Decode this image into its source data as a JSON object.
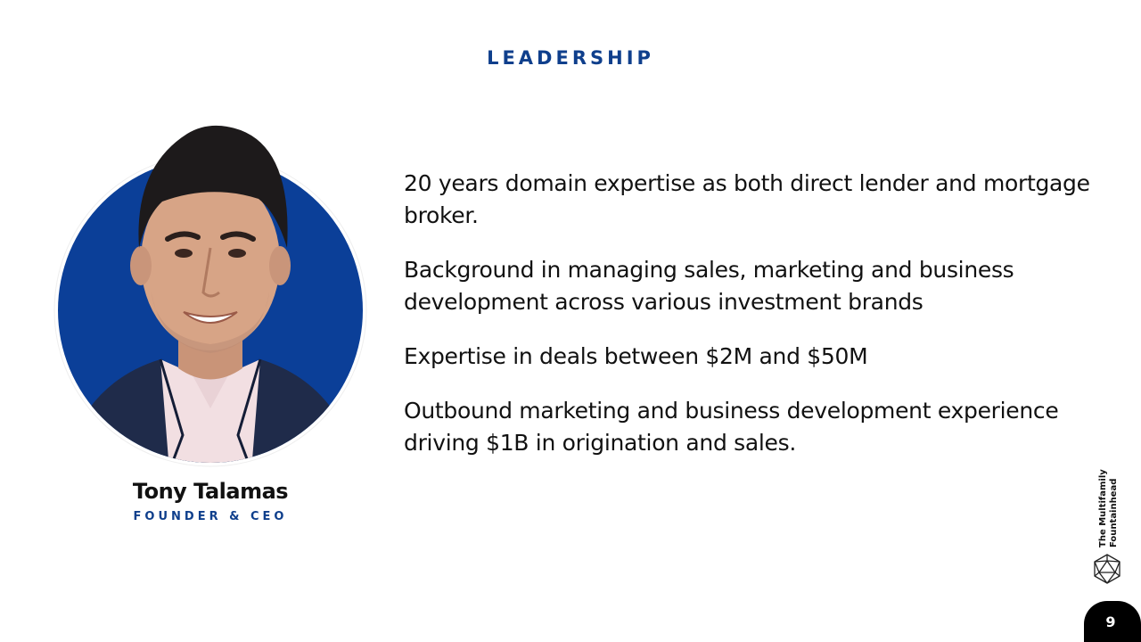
{
  "slide": {
    "title": "LEADERSHIP",
    "person": {
      "name": "Tony Talamas",
      "role": "FOUNDER & CEO"
    },
    "bullets": [
      "20 years domain expertise as both direct lender and mortgage broker.",
      "Background in managing sales, marketing and business development across various investment brands",
      "Expertise in deals between $2M and $50M",
      "Outbound marketing and business development experience driving $1B in origination and sales."
    ],
    "brand": {
      "line1": "The Multifamily",
      "line2": "Fountainhead",
      "logo_icon": "icosahedron-logo-icon"
    },
    "page_number": "9"
  },
  "colors": {
    "accent": "#0f3f8c",
    "photo_background": "#0b3f98",
    "text": "#111111",
    "badge": "#000000"
  }
}
